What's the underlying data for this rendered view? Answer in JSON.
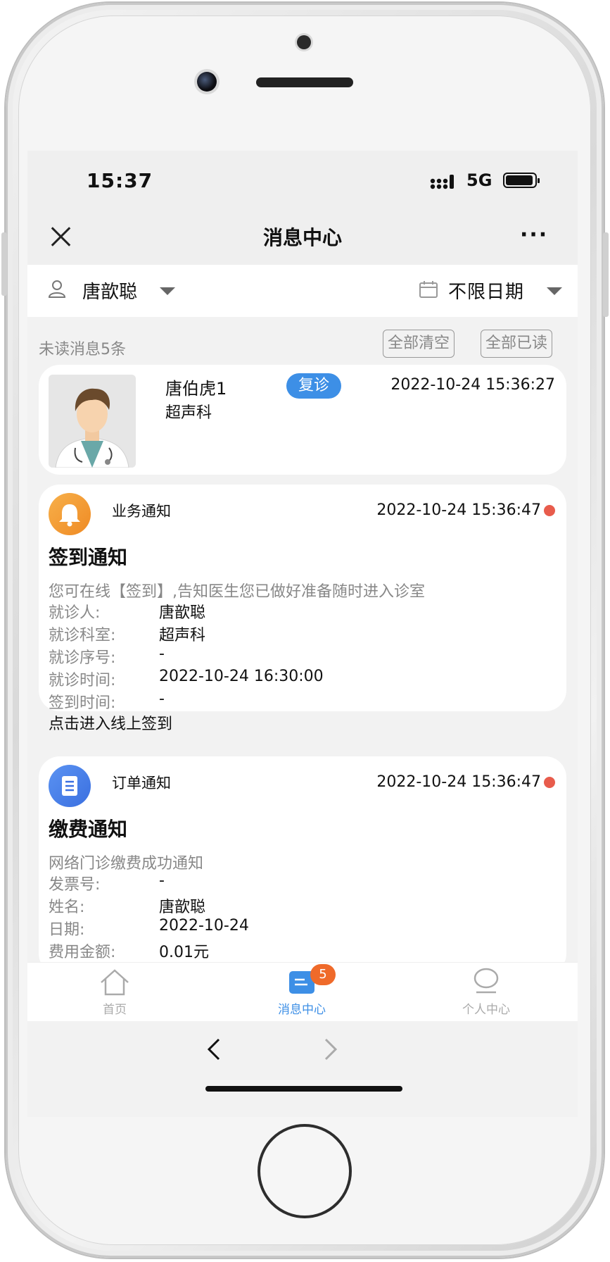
{
  "status_bar": {
    "time": "15:37",
    "network": "5G"
  },
  "nav": {
    "title": "消息中心"
  },
  "filters": {
    "user": "唐歆聪",
    "date": "不限日期"
  },
  "unread": {
    "text": "未读消息5条",
    "clear_all": "全部清空",
    "mark_all_read": "全部已读"
  },
  "doctor_card": {
    "name": "唐伯虎1",
    "tag": "复诊",
    "time": "2022-10-24 15:36:27",
    "department": "超声科"
  },
  "business_notice": {
    "category": "业务通知",
    "time": "2022-10-24 15:36:47",
    "title": "签到通知",
    "description": "您可在线【签到】,告知医生您已做好准备随时进入诊室",
    "rows": [
      {
        "label": "就诊人:",
        "value": "唐歆聪"
      },
      {
        "label": "就诊科室:",
        "value": "超声科"
      },
      {
        "label": "就诊序号:",
        "value": "-"
      },
      {
        "label": "就诊时间:",
        "value": "2022-10-24 16:30:00"
      },
      {
        "label": "签到时间:",
        "value": "-"
      }
    ],
    "action": "点击进入线上签到"
  },
  "order_notice": {
    "category": "订单通知",
    "time": "2022-10-24 15:36:47",
    "title": "缴费通知",
    "description": "网络门诊缴费成功通知",
    "rows": [
      {
        "label": "发票号:",
        "value": "-"
      },
      {
        "label": "姓名:",
        "value": "唐歆聪"
      },
      {
        "label": "日期:",
        "value": "2022-10-24"
      },
      {
        "label": "费用金额:",
        "value": "0.01元"
      }
    ]
  },
  "tabbar": {
    "home": "首页",
    "messages": "消息中心",
    "messages_badge": "5",
    "profile": "个人中心"
  },
  "colors": {
    "accent": "#3d8fe6",
    "badge": "#ef6a2a",
    "unread_dot": "#e85c4c",
    "bell": "#f39a2e"
  }
}
